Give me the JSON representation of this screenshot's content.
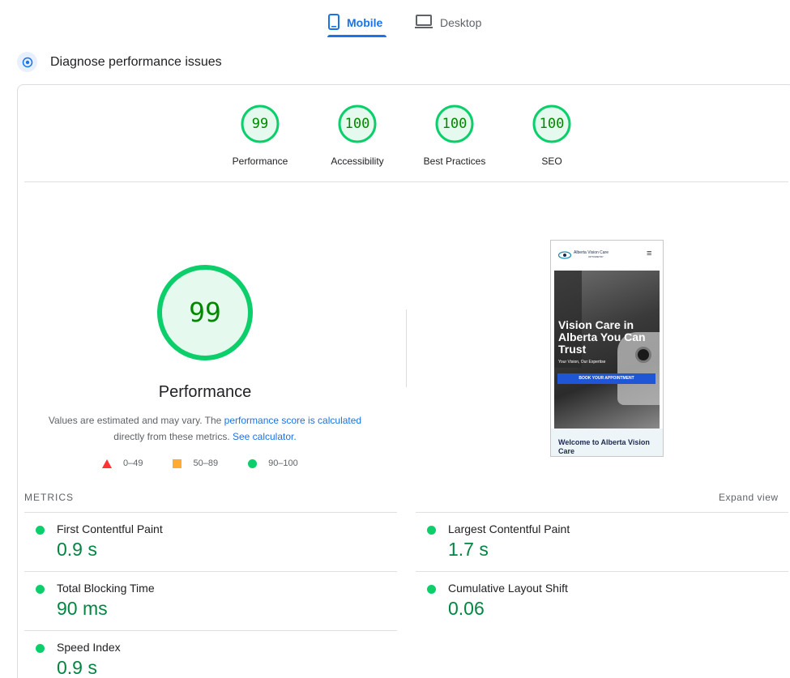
{
  "tabs": {
    "mobile": "Mobile",
    "desktop": "Desktop"
  },
  "section": {
    "title": "Diagnose performance issues"
  },
  "categories": [
    {
      "score": "99",
      "label": "Performance"
    },
    {
      "score": "100",
      "label": "Accessibility"
    },
    {
      "score": "100",
      "label": "Best Practices"
    },
    {
      "score": "100",
      "label": "SEO"
    }
  ],
  "performance": {
    "score": "99",
    "title": "Performance",
    "desc_part1": "Values are estimated and may vary. The ",
    "desc_link1": "performance score is calculated",
    "desc_part2": " directly from these metrics. ",
    "desc_link2": "See calculator."
  },
  "legend": {
    "fail": "0–49",
    "average": "50–89",
    "pass": "90–100"
  },
  "screenshot": {
    "logo_text": "Alberta Vision Care",
    "logo_sub": "OPTOMETRY",
    "hero_title": "Vision Care in Alberta You Can Trust",
    "hero_subtitle": "Your Vision, Our Expertise",
    "hero_button": "BOOK YOUR APPOINTMENT",
    "welcome": "Welcome to Alberta Vision Care"
  },
  "metrics": {
    "label": "METRICS",
    "expand": "Expand view",
    "items": [
      {
        "name": "First Contentful Paint",
        "value": "0.9 s"
      },
      {
        "name": "Largest Contentful Paint",
        "value": "1.7 s"
      },
      {
        "name": "Total Blocking Time",
        "value": "90 ms"
      },
      {
        "name": "Cumulative Layout Shift",
        "value": "0.06"
      },
      {
        "name": "Speed Index",
        "value": "0.9 s"
      }
    ]
  },
  "colors": {
    "accent": "#1a73e8",
    "pass": "#0cce6b",
    "pass_text": "#008800",
    "average": "#ffaa33",
    "fail": "#ff3333"
  }
}
